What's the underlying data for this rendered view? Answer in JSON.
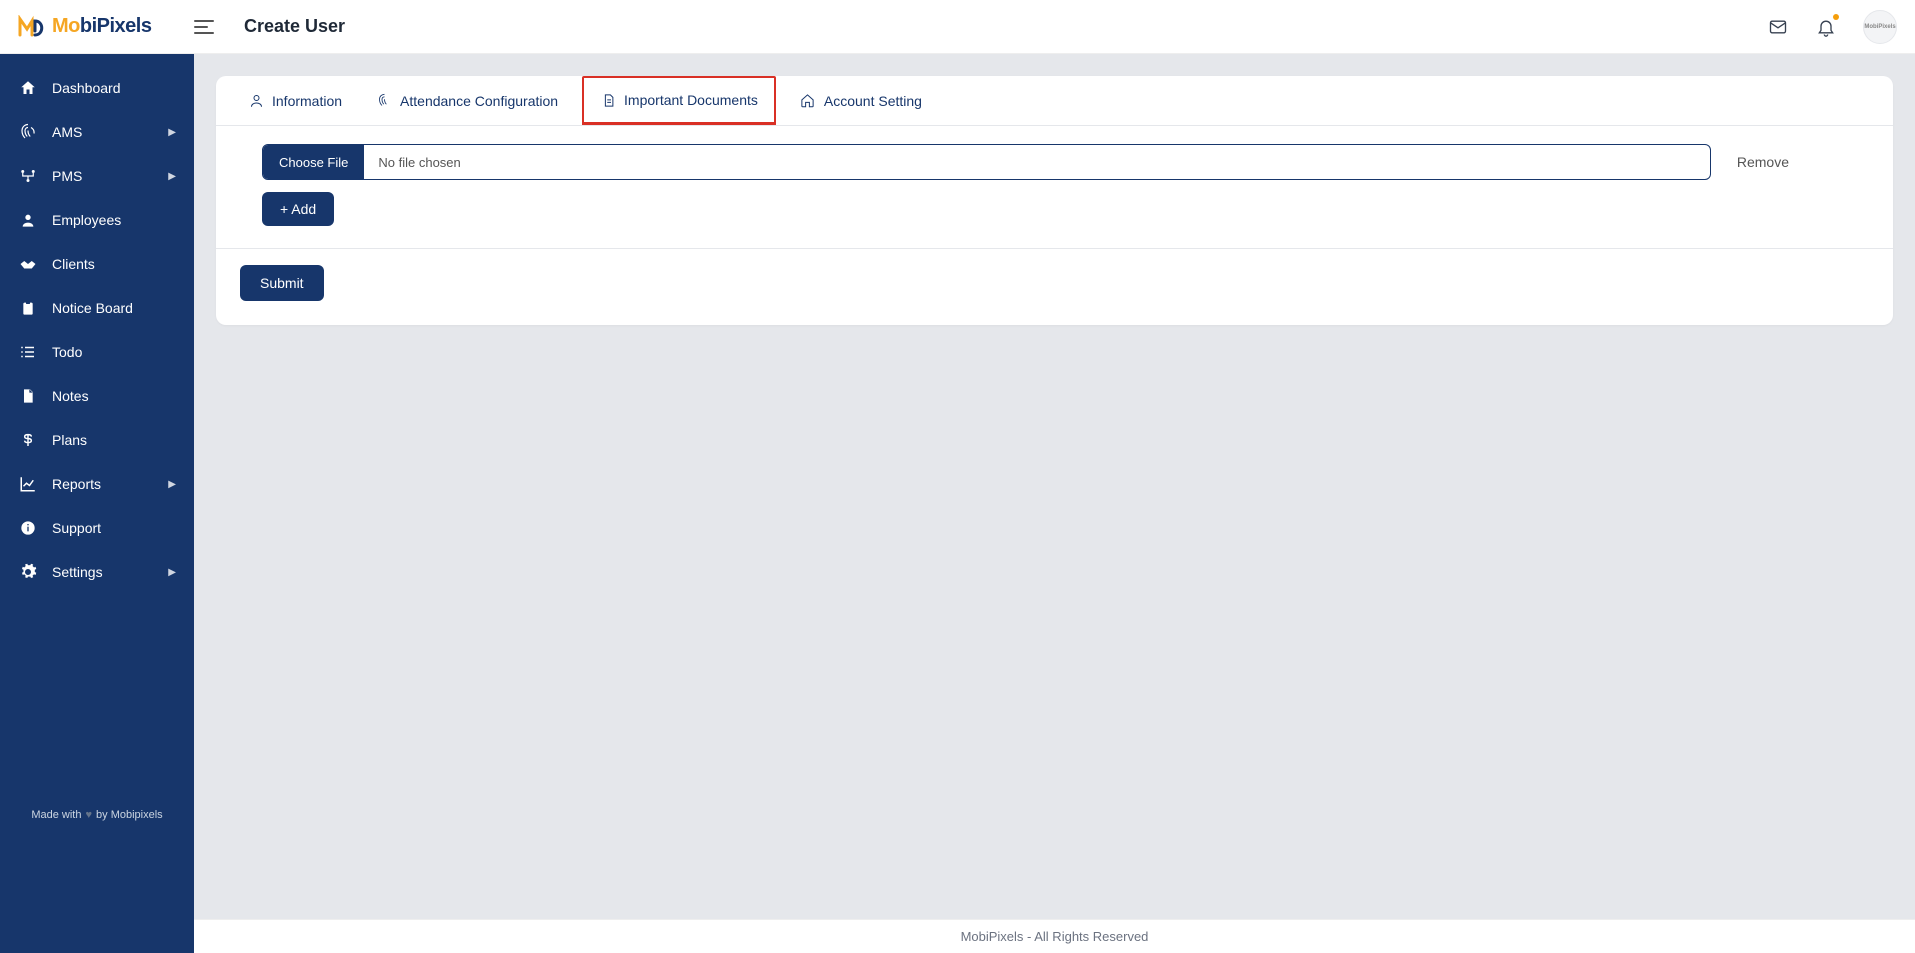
{
  "brand": {
    "name": "MobiPixels",
    "avatar_text": "MobiPixels"
  },
  "header": {
    "page_title": "Create User"
  },
  "sidebar": {
    "items": [
      {
        "label": "Dashboard",
        "icon": "home",
        "expandable": false
      },
      {
        "label": "AMS",
        "icon": "fingerprint",
        "expandable": true
      },
      {
        "label": "PMS",
        "icon": "network",
        "expandable": true
      },
      {
        "label": "Employees",
        "icon": "user",
        "expandable": false
      },
      {
        "label": "Clients",
        "icon": "handshake",
        "expandable": false
      },
      {
        "label": "Notice Board",
        "icon": "clipboard",
        "expandable": false
      },
      {
        "label": "Todo",
        "icon": "list",
        "expandable": false
      },
      {
        "label": "Notes",
        "icon": "file",
        "expandable": false
      },
      {
        "label": "Plans",
        "icon": "dollar",
        "expandable": false
      },
      {
        "label": "Reports",
        "icon": "chart",
        "expandable": true
      },
      {
        "label": "Support",
        "icon": "info",
        "expandable": false
      },
      {
        "label": "Settings",
        "icon": "gear",
        "expandable": true
      }
    ],
    "footer_prefix": "Made with",
    "footer_suffix": "by Mobipixels"
  },
  "tabs": {
    "information": "Information",
    "attendance": "Attendance Configuration",
    "documents": "Important Documents",
    "account": "Account Setting"
  },
  "form": {
    "choose_file": "Choose File",
    "no_file": "No file chosen",
    "remove": "Remove",
    "add": "+ Add",
    "submit": "Submit"
  },
  "footer": {
    "text": "MobiPixels - All Rights Reserved"
  }
}
